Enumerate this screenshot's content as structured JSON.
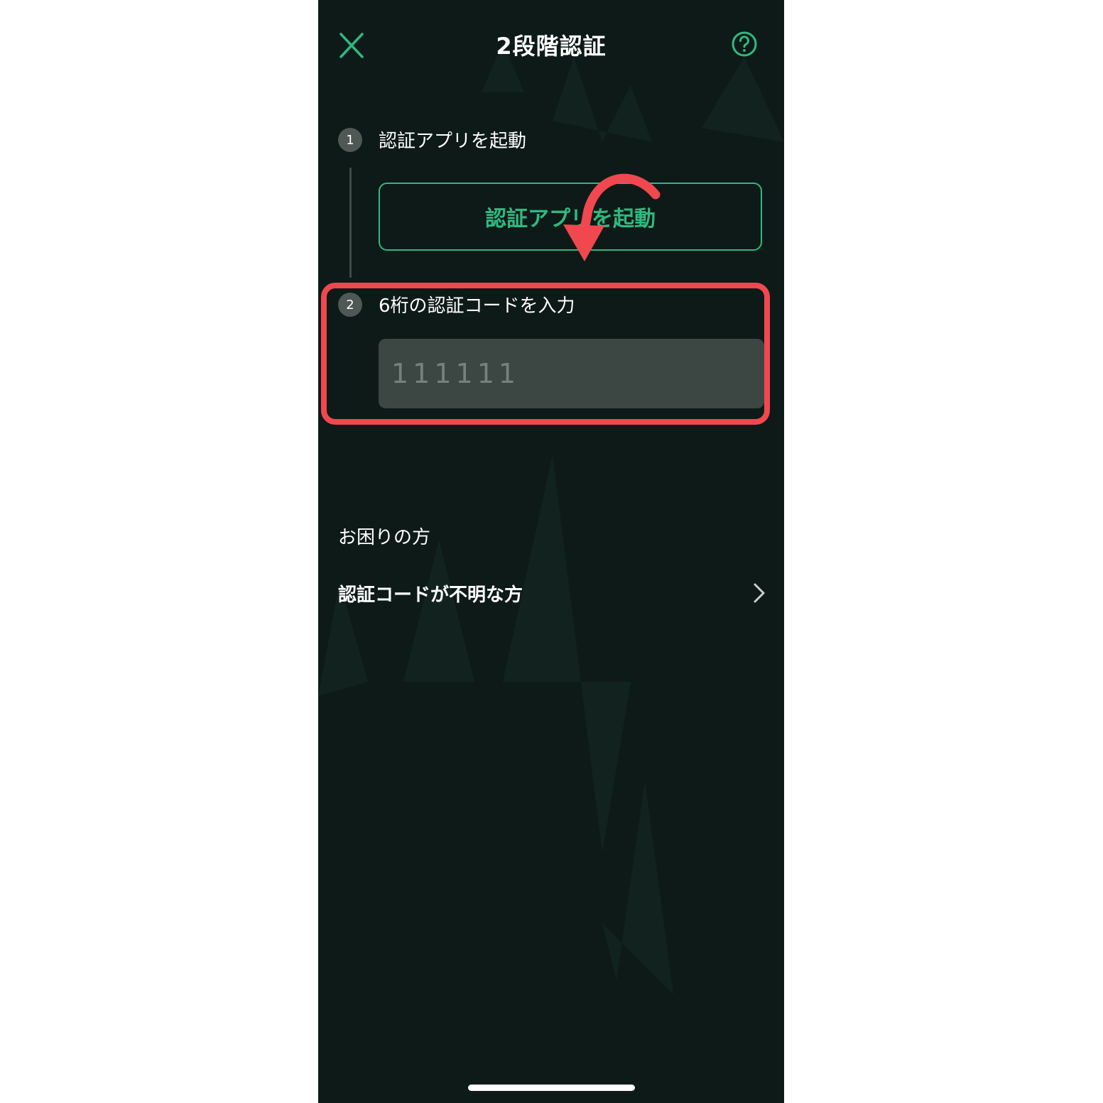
{
  "header": {
    "title": "2段階認証",
    "close_icon": "close-icon",
    "help_icon": "help-circle-icon"
  },
  "steps": [
    {
      "number": "1",
      "label": "認証アプリを起動",
      "button_label": "認証アプリを起動"
    },
    {
      "number": "2",
      "label": "6桁の認証コードを入力",
      "input_placeholder": "111111",
      "input_value": ""
    }
  ],
  "help": {
    "heading": "お困りの方",
    "link_label": "認証コードが不明な方",
    "link_icon": "chevron-right-icon"
  },
  "colors": {
    "background": "#0e1a18",
    "accent": "#2fb980",
    "annotation": "#f0484e",
    "input_bg": "#3c4743"
  }
}
